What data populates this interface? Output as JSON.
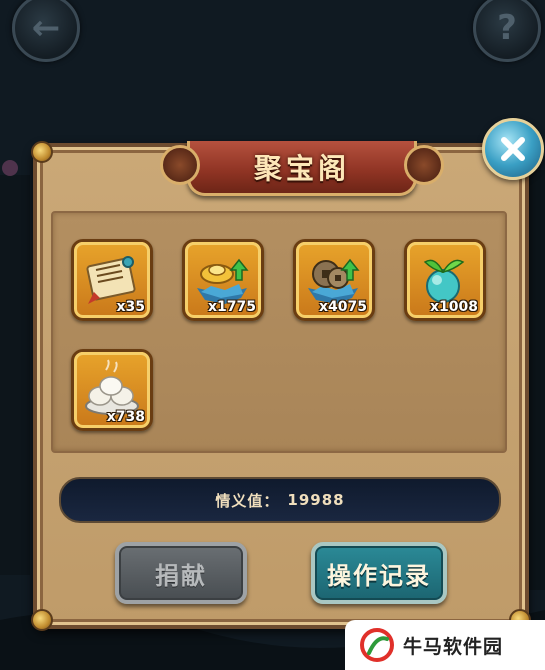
{
  "window": {
    "title": "聚宝阁"
  },
  "items": [
    {
      "icon": "scroll-icon",
      "qty": "x35"
    },
    {
      "icon": "gold-ingot-upgrade-icon",
      "qty": "x1775"
    },
    {
      "icon": "coin-upgrade-icon",
      "qty": "x4075"
    },
    {
      "icon": "sprout-orb-icon",
      "qty": "x1008"
    },
    {
      "icon": "steamed-buns-icon",
      "qty": "x738"
    }
  ],
  "stat": {
    "label": "情义值：",
    "value": "19988"
  },
  "buttons": {
    "donate_label": "捐献",
    "log_label": "操作记录"
  },
  "watermark": {
    "text": "牛马软件园"
  },
  "colors": {
    "panel": "#c6a472",
    "title_plate": "#8e3323",
    "slot": "#e09a26",
    "log_button": "#1f6f7c",
    "donate_button_disabled": "#5a5f63"
  }
}
